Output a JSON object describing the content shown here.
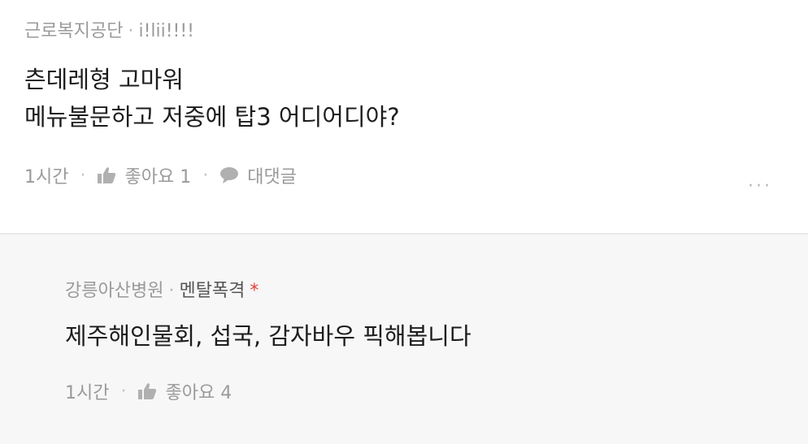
{
  "comments": [
    {
      "author": "근로복지공단",
      "nickname": "i!lii!!!!",
      "lines": [
        "츤데레형 고마워",
        "메뉴불문하고 저중에 탑3 어디어디야?"
      ],
      "time": "1시간",
      "like_label": "좋아요 1",
      "reply_label": "대댓글",
      "more": "···",
      "icons": [
        "thumbs-up-icon",
        "speech-bubble-icon"
      ]
    },
    {
      "author": "강릉아산병원",
      "nickname": "멘탈폭격",
      "badge": "*",
      "lines": [
        "제주해인물회, 섭국, 감자바우 픽해봅니다"
      ],
      "time": "1시간",
      "like_label": "좋아요 4",
      "icons": [
        "thumbs-up-icon"
      ]
    }
  ],
  "colors": {
    "meta": "#9a9a9a",
    "text": "#1d1d1d",
    "reply_bg": "#f7f7f7",
    "badge": "#e0413a"
  }
}
